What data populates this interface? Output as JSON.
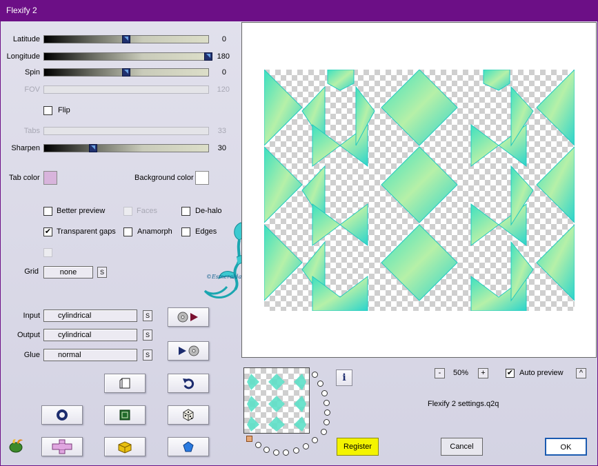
{
  "window": {
    "title": "Flexify 2"
  },
  "sliders": {
    "latitude": {
      "label": "Latitude",
      "value": "0",
      "fraction": 0.5
    },
    "longitude": {
      "label": "Longitude",
      "value": "180",
      "fraction": 1.0
    },
    "spin": {
      "label": "Spin",
      "value": "0",
      "fraction": 0.5
    },
    "fov": {
      "label": "FOV",
      "value": "120",
      "fraction": null
    },
    "tabs": {
      "label": "Tabs",
      "value": "33",
      "fraction": null
    },
    "sharpen": {
      "label": "Sharpen",
      "value": "30",
      "fraction": 0.3
    }
  },
  "flip": {
    "label": "Flip",
    "checked": false
  },
  "colors": {
    "tab_color_label": "Tab color",
    "tab_color": "#d8b4dc",
    "background_color_label": "Background color",
    "background_color": "#ffffff"
  },
  "options": {
    "better_preview": {
      "label": "Better preview",
      "checked": false
    },
    "faces": {
      "label": "Faces",
      "checked": false
    },
    "de_halo": {
      "label": "De-halo",
      "checked": false
    },
    "transparent_gaps": {
      "label": "Transparent gaps",
      "checked": true
    },
    "anamorph": {
      "label": "Anamorph",
      "checked": false
    },
    "edges": {
      "label": "Edges",
      "checked": false
    }
  },
  "grid": {
    "label": "Grid",
    "value": "none",
    "s_label": "S"
  },
  "mapping": {
    "input": {
      "label": "Input",
      "value": "cylindrical"
    },
    "output": {
      "label": "Output",
      "value": "cylindrical"
    },
    "glue": {
      "label": "Glue",
      "value": "normal"
    },
    "s_label": "S"
  },
  "watermark_text": "©Esmeralda Wien",
  "zoom": {
    "value": "50%",
    "minus": "-",
    "plus": "+"
  },
  "auto_preview": {
    "label": "Auto preview",
    "checked": true,
    "button": "^"
  },
  "settings_file": "Flexify 2 settings.q2q",
  "buttons": {
    "register": "Register",
    "cancel": "Cancel",
    "ok": "OK",
    "info": "i"
  },
  "icons": {
    "load": "disc-load-icon",
    "save": "disc-save-icon",
    "copy": "copy-icon",
    "undo": "undo-icon",
    "ring": "ring-icon",
    "square": "square-icon",
    "dice": "dice-icon",
    "cross": "cross-icon",
    "cube": "cube-icon",
    "pentagon": "pentagon-icon",
    "logo": "flaming-pear-logo"
  },
  "accent": "#6c0f86"
}
